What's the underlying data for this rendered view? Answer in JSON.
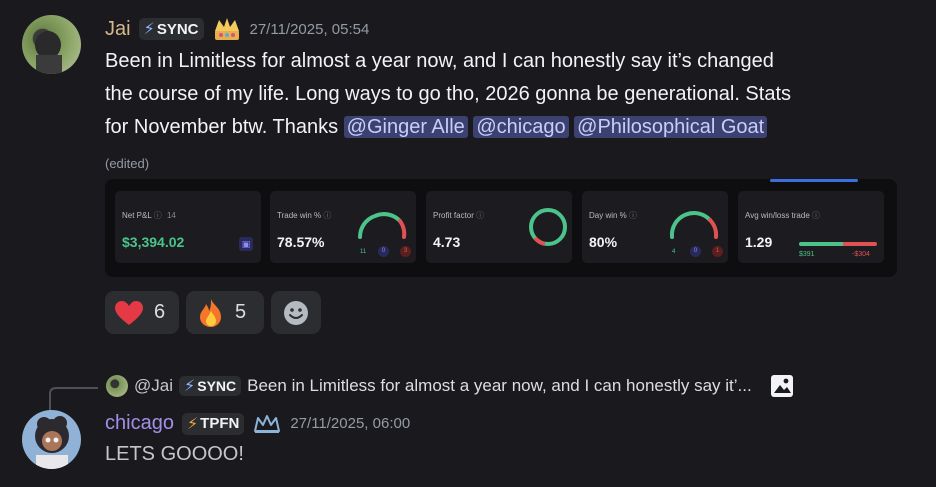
{
  "message1": {
    "username": "Jai",
    "tag": "SYNC",
    "timestamp": "27/11/2025, 05:54",
    "text_line1": "Been in Limitless for almost a year now, and I can honestly say it’s changed",
    "text_line2": "the course of my life. Long ways to go tho, 2026 gonna be generational. Stats",
    "text_line3_prefix": "for November btw. Thanks",
    "mentions": [
      "@Ginger Alle",
      "@chicago",
      "@Philosophical Goat"
    ],
    "edited": "(edited)",
    "colors": {
      "username": "#d6b98c",
      "mention_bg": "#3c4270",
      "mention_text": "#c9cdfb"
    }
  },
  "stats": {
    "net_pnl": {
      "label": "Net P&L",
      "count": "14",
      "value": "$3,394.02",
      "color": "#4cc38a"
    },
    "trade_win": {
      "label": "Trade win %",
      "value": "78.57%",
      "wins": "11",
      "even": "0",
      "losses": "3"
    },
    "profit_factor": {
      "label": "Profit factor",
      "value": "4.73"
    },
    "day_win": {
      "label": "Day win %",
      "value": "80%",
      "wins": "4",
      "even": "0",
      "losses": "1"
    },
    "avg_win_loss": {
      "label": "Avg win/loss trade",
      "value": "1.29",
      "avg_win": "$391",
      "avg_loss": "-$304"
    }
  },
  "reactions": [
    {
      "icon": "heart-icon",
      "count": "6"
    },
    {
      "icon": "fire-icon",
      "count": "5"
    },
    {
      "icon": "add-reaction-icon",
      "count": ""
    }
  ],
  "reply": {
    "ref_username": "@Jai",
    "ref_tag": "SYNC",
    "ref_text": "Been in Limitless for almost a year now, and I can honestly say it’...",
    "username": "chicago",
    "tag": "TPFN",
    "timestamp": "27/11/2025, 06:00",
    "text": "LETS GOOOO!",
    "colors": {
      "username": "#a48ee8",
      "text": "#c4c6c9"
    }
  }
}
